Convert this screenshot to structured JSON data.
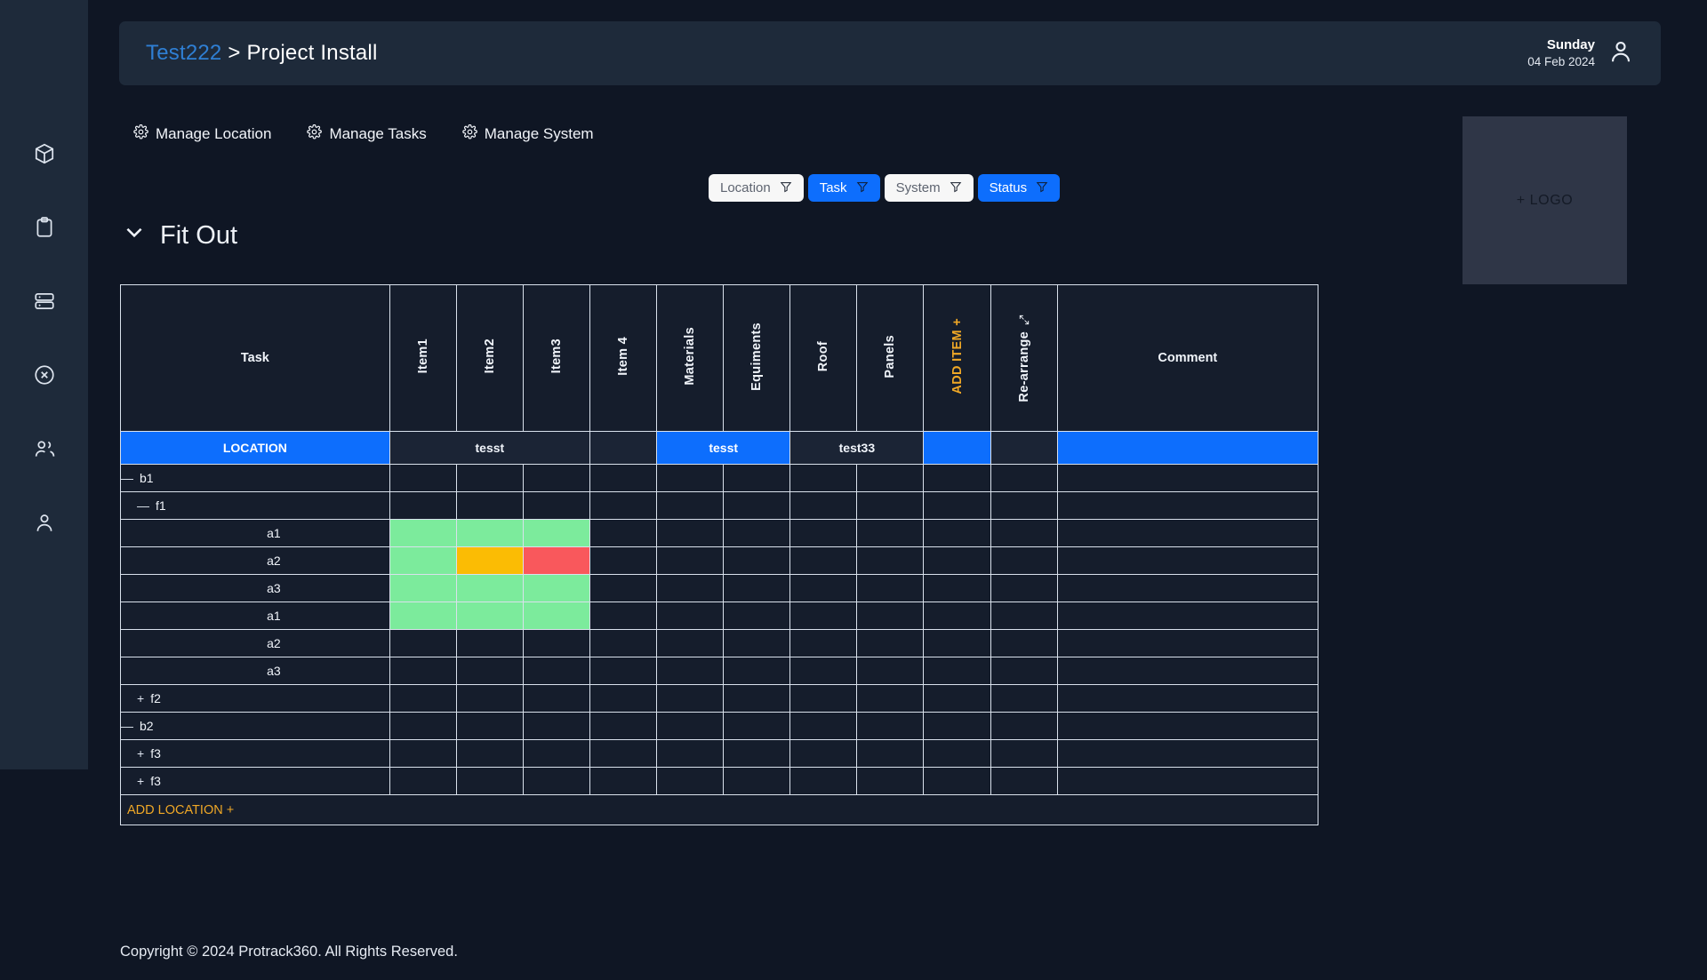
{
  "header": {
    "breadcrumb_project": "Test222",
    "breadcrumb_separator": ">",
    "breadcrumb_page": "Project Install",
    "day_of_week": "Sunday",
    "date": "04 Feb 2024",
    "avatar_icon": "user-icon"
  },
  "sidebar": {
    "items": [
      {
        "icon": "box-icon"
      },
      {
        "icon": "clipboard-icon"
      },
      {
        "icon": "server-icon"
      },
      {
        "icon": "x-circle-icon"
      },
      {
        "icon": "users-icon"
      },
      {
        "icon": "user-icon"
      }
    ]
  },
  "manage": {
    "links": [
      {
        "label": "Manage Location",
        "icon": "gear-icon"
      },
      {
        "label": "Manage Tasks",
        "icon": "gear-icon"
      },
      {
        "label": "Manage System",
        "icon": "gear-icon"
      }
    ]
  },
  "logo": {
    "label": "+ LOGO"
  },
  "filters": [
    {
      "label": "Location",
      "icon": "filter-icon",
      "active": false
    },
    {
      "label": "Task",
      "icon": "filter-icon",
      "active": true
    },
    {
      "label": "System",
      "icon": "filter-icon",
      "active": false
    },
    {
      "label": "Status",
      "icon": "filter-icon",
      "active": true
    }
  ],
  "section": {
    "title": "Fit Out",
    "toggle_icon": "chevron-down-icon"
  },
  "table": {
    "headers": {
      "task": "Task",
      "rotated": [
        "Item1",
        "Item2",
        "Item3",
        "Item 4",
        "Materials",
        "Equiments",
        "Roof",
        "Panels"
      ],
      "add_item": "ADD ITEM +",
      "rearrange": "Re-arrange",
      "rearrange_icon": "resize-arrows-icon",
      "comment": "Comment"
    },
    "location_band": {
      "label": "LOCATION",
      "groups": [
        {
          "label": "tesst",
          "span": 3,
          "style": "dark"
        },
        {
          "label": "",
          "span": 1,
          "style": "dark"
        },
        {
          "label": "tesst",
          "span": 2,
          "style": "blue"
        },
        {
          "label": "test33",
          "span": 2,
          "style": "dark"
        },
        {
          "label": "",
          "span": 1,
          "style": "blue"
        },
        {
          "label": "",
          "span": 1,
          "style": "dark"
        },
        {
          "label": "",
          "span": 1,
          "style": "blue"
        }
      ]
    },
    "rows": [
      {
        "toggle": "—",
        "label": "b1",
        "level": 0,
        "statuses": []
      },
      {
        "toggle": "—",
        "label": "f1",
        "level": 1,
        "statuses": []
      },
      {
        "toggle": "",
        "label": "a1",
        "level": 2,
        "statuses": [
          "green",
          "green",
          "green"
        ]
      },
      {
        "toggle": "",
        "label": "a2",
        "level": 2,
        "statuses": [
          "green",
          "amber",
          "red"
        ]
      },
      {
        "toggle": "",
        "label": "a3",
        "level": 2,
        "statuses": [
          "green",
          "green",
          "green"
        ]
      },
      {
        "toggle": "",
        "label": "a1",
        "level": 2,
        "statuses": [
          "green",
          "green",
          "green"
        ]
      },
      {
        "toggle": "",
        "label": "a2",
        "level": 2,
        "statuses": []
      },
      {
        "toggle": "",
        "label": "a3",
        "level": 2,
        "statuses": []
      },
      {
        "toggle": "+",
        "label": "f2",
        "level": 1,
        "statuses": []
      },
      {
        "toggle": "—",
        "label": "b2",
        "level": 0,
        "statuses": []
      },
      {
        "toggle": "+",
        "label": "f3",
        "level": 1,
        "statuses": []
      },
      {
        "toggle": "+",
        "label": "f3",
        "level": 1,
        "statuses": []
      }
    ],
    "add_location": "ADD LOCATION +"
  },
  "footer": {
    "copyright": "Copyright © 2024 Protrack360. All Rights Reserved."
  },
  "colors": {
    "accent_blue": "#0d6efd",
    "link_blue": "#2f7fd4",
    "amber": "#f0a826",
    "status_green": "#7ceb9c",
    "status_amber": "#fbbc04",
    "status_red": "#f9585c",
    "panel": "#1e2a3a",
    "page_bg": "#0f1624"
  }
}
